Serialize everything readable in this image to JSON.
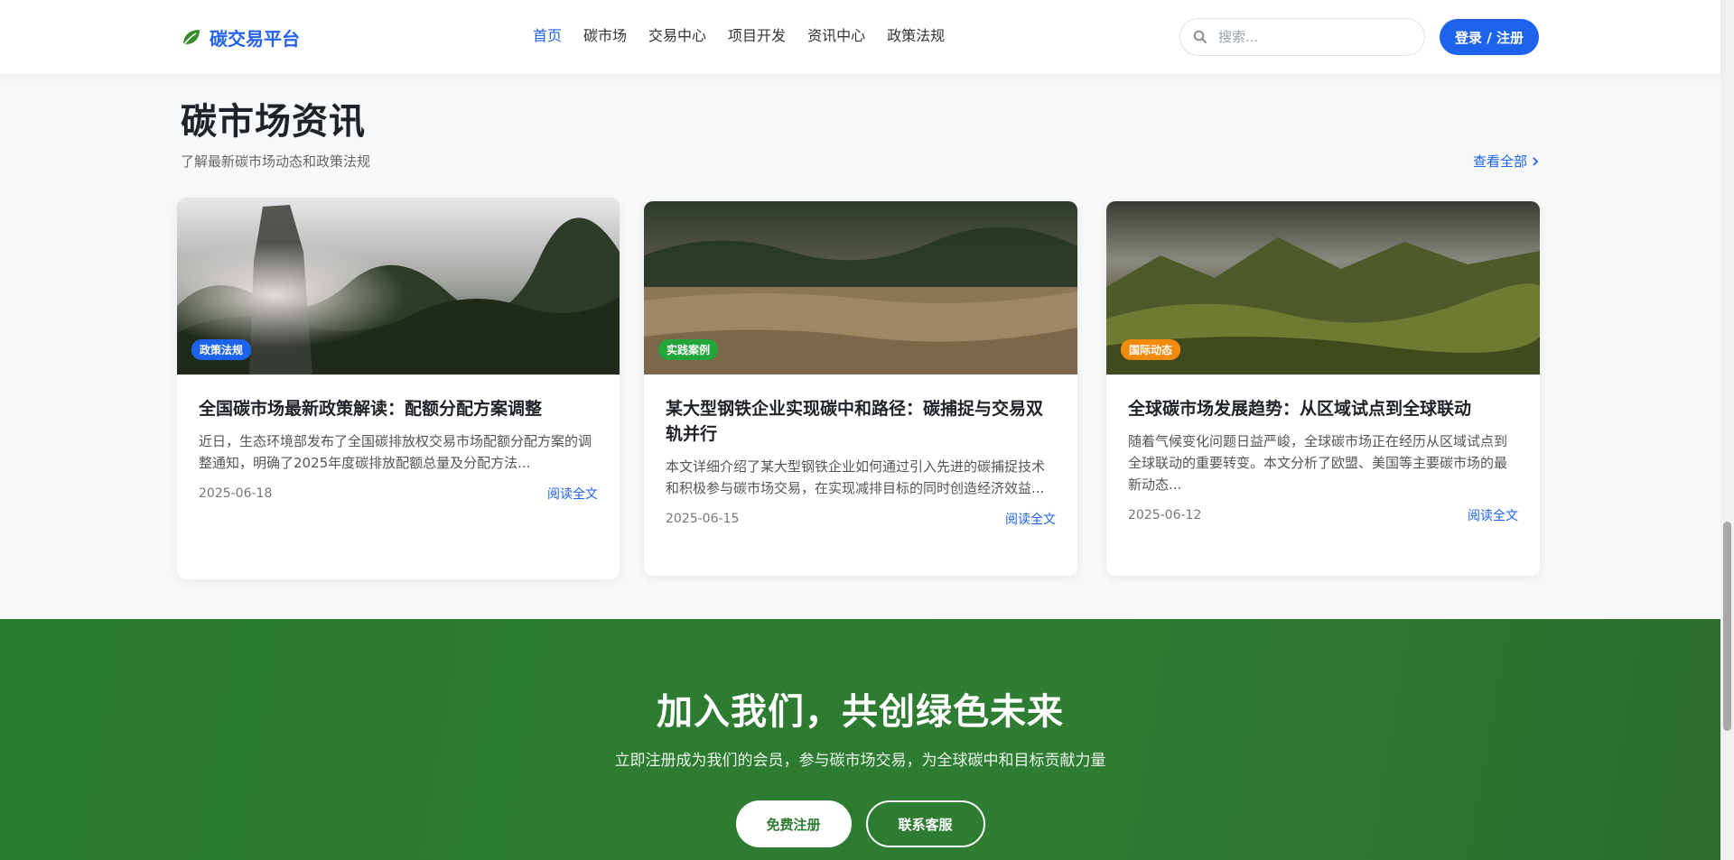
{
  "header": {
    "logo_text": "碳交易平台",
    "nav": [
      {
        "label": "首页",
        "active": true
      },
      {
        "label": "碳市场",
        "active": false
      },
      {
        "label": "交易中心",
        "active": false
      },
      {
        "label": "项目开发",
        "active": false
      },
      {
        "label": "资讯中心",
        "active": false
      },
      {
        "label": "政策法规",
        "active": false
      }
    ],
    "search_placeholder": "搜索...",
    "login_label": "登录 / 注册"
  },
  "news": {
    "title": "碳市场资讯",
    "subtitle": "了解最新碳市场动态和政策法规",
    "view_all": "查看全部",
    "cards": [
      {
        "tag": "政策法规",
        "tag_color": "#1d63ed",
        "title": "全国碳市场最新政策解读：配额分配方案调整",
        "desc": "近日，生态环境部发布了全国碳排放权交易市场配额分配方案的调整通知，明确了2025年度碳排放配额总量及分配方法...",
        "date": "2025-06-18",
        "link": "阅读全文"
      },
      {
        "tag": "实践案例",
        "tag_color": "#22a63a",
        "title": "某大型钢铁企业实现碳中和路径：碳捕捉与交易双轨并行",
        "desc": "本文详细介绍了某大型钢铁企业如何通过引入先进的碳捕捉技术和积极参与碳市场交易，在实现减排目标的同时创造经济效益...",
        "date": "2025-06-15",
        "link": "阅读全文"
      },
      {
        "tag": "国际动态",
        "tag_color": "#f28a0e",
        "title": "全球碳市场发展趋势：从区域试点到全球联动",
        "desc": "随着气候变化问题日益严峻，全球碳市场正在经历从区域试点到全球联动的重要转变。本文分析了欧盟、美国等主要碳市场的最新动态...",
        "date": "2025-06-12",
        "link": "阅读全文"
      }
    ]
  },
  "cta": {
    "title": "加入我们，共创绿色未来",
    "subtitle": "立即注册成为我们的会员，参与碳市场交易，为全球碳中和目标贡献力量",
    "primary_label": "免费注册",
    "secondary_label": "联系客服"
  },
  "colors": {
    "brand": "#1d63ed",
    "cta_green": "#2f7d33"
  },
  "icons": {
    "logo": "leaf-icon",
    "search": "search-icon",
    "view_all": "chevron-right-icon"
  }
}
